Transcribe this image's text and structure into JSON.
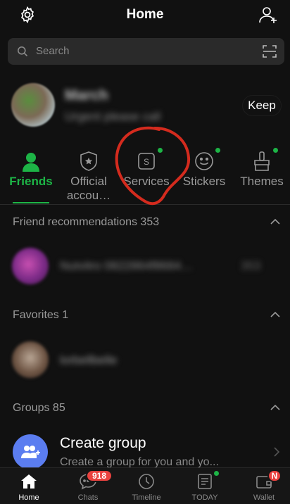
{
  "header": {
    "title": "Home"
  },
  "search": {
    "placeholder": "Search"
  },
  "profile": {
    "name": "March",
    "status": "Urgent please call",
    "keep_label": "Keep"
  },
  "tabs": [
    {
      "label": "Friends",
      "active": true
    },
    {
      "label": "Official accou…",
      "active": false
    },
    {
      "label": "Services",
      "active": false
    },
    {
      "label": "Stickers",
      "active": false
    },
    {
      "label": "Themes",
      "active": false
    }
  ],
  "sections": {
    "friend_recommendations": {
      "title": "Friend recommendations 353",
      "item_name": "Nutvitro 0822864f8684…",
      "item_count": "353"
    },
    "favorites": {
      "title": "Favorites 1",
      "item_name": "lorbellbelle"
    },
    "groups": {
      "title": "Groups 85",
      "create_title": "Create group",
      "create_subtitle": "Create a group for you and yo..."
    }
  },
  "bottom_nav": [
    {
      "label": "Home",
      "active": true
    },
    {
      "label": "Chats",
      "badge": "918"
    },
    {
      "label": "Timeline"
    },
    {
      "label": "TODAY"
    },
    {
      "label": "Wallet",
      "badge": "N"
    }
  ],
  "colors": {
    "accent": "#1db446",
    "badge": "#e9423f",
    "background": "#111111",
    "annotation": "#d42b1e",
    "group_avatar": "#5b7df0"
  }
}
